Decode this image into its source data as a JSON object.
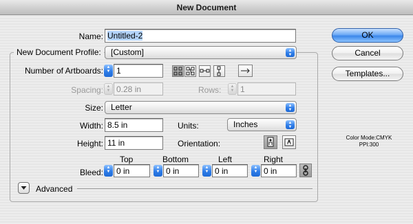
{
  "window": {
    "title": "New Document"
  },
  "name": {
    "label": "Name:",
    "value": "Untitled-2"
  },
  "profile": {
    "label": "New Document Profile:",
    "value": "[Custom]"
  },
  "artboards": {
    "label": "Number of Artboards:",
    "value": "1",
    "arrangement_icons": [
      "grid-by-row-icon",
      "grid-by-column-icon",
      "arrange-by-row-icon",
      "arrange-by-column-icon"
    ],
    "direction_icon": "right-to-left-layout-icon"
  },
  "spacing": {
    "label": "Spacing:",
    "value": "0.28 in"
  },
  "rows": {
    "label": "Rows:",
    "value": "1"
  },
  "size": {
    "label": "Size:",
    "value": "Letter"
  },
  "width": {
    "label": "Width:",
    "value": "8.5 in"
  },
  "units": {
    "label": "Units:",
    "value": "Inches"
  },
  "height": {
    "label": "Height:",
    "value": "11 in"
  },
  "orientation": {
    "label": "Orientation:",
    "selected": "portrait"
  },
  "bleed": {
    "label": "Bleed:",
    "top_label": "Top",
    "top": "0 in",
    "bottom_label": "Bottom",
    "bottom": "0 in",
    "left_label": "Left",
    "left": "0 in",
    "right_label": "Right",
    "right": "0 in"
  },
  "advanced": {
    "label": "Advanced"
  },
  "buttons": {
    "ok": "OK",
    "cancel": "Cancel",
    "templates": "Templates..."
  },
  "info": {
    "color_mode": "Color Mode:CMYK",
    "ppi": "PPI:300"
  },
  "colors": {
    "accent": "#3c87ea",
    "selection": "#b4d4fb"
  }
}
